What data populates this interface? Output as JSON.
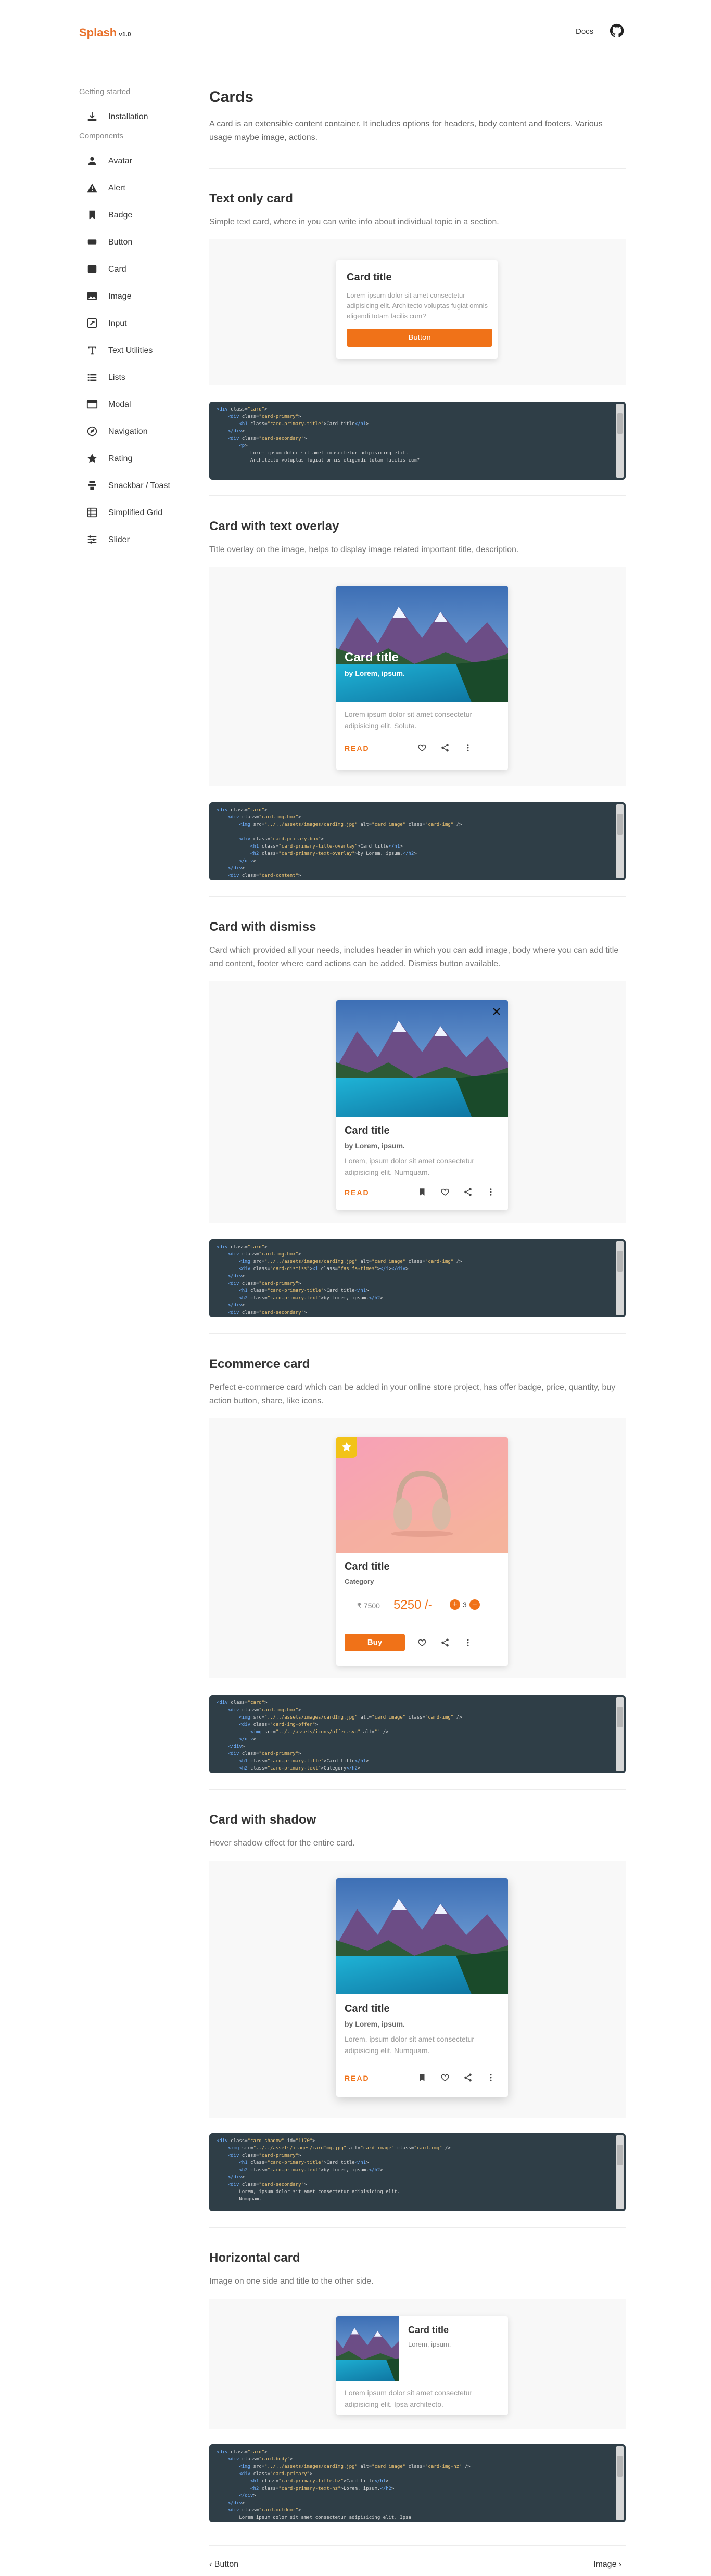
{
  "brand": {
    "name": "Splash",
    "version": "v1.0"
  },
  "topnav": {
    "docs": "Docs"
  },
  "sidebar": {
    "getting_started": "Getting started",
    "installation": "Installation",
    "components": "Components",
    "items": [
      "Avatar",
      "Alert",
      "Badge",
      "Button",
      "Card",
      "Image",
      "Input",
      "Text Utilities",
      "Lists",
      "Modal",
      "Navigation",
      "Rating",
      "Snackbar / Toast",
      "Simplified Grid",
      "Slider"
    ]
  },
  "page": {
    "title": "Cards",
    "lead": "A card is an extensible content container. It includes options for headers, body content and footers. Various usage maybe image, actions."
  },
  "sections": {
    "text_only": {
      "title": "Text only card",
      "desc": "Simple text card, where in you can write info about individual topic in a section.",
      "card_title": "Card title",
      "card_text": "Lorem ipsum dolor sit amet consectetur adipisicing elit. Architecto voluptas fugiat omnis eligendi totam facilis cum?",
      "button": "Button",
      "code": [
        "<div class=\"card\">",
        "    <div class=\"card-primary\">",
        "        <h1 class=\"card-primary-title\">Card title</h1>",
        "    </div>",
        "    <div class=\"card-secondary\">",
        "        <p>",
        "            Lorem ipsum dolor sit amet consectetur adipisicing elit.",
        "            Architecto voluptas fugiat omnis eligendi totam facilis cum?"
      ]
    },
    "overlay": {
      "title": "Card with text overlay",
      "desc": "Title overlay on the image, helps to display image related important title, description.",
      "card_title": "Card title",
      "card_sub": "by Lorem, ipsum.",
      "card_text": "Lorem ipsum dolor sit amet consectetur adipisicing elit. Soluta.",
      "read": "READ",
      "code": [
        "<div class=\"card\">",
        "    <div class=\"card-img-box\">",
        "        <img src=\"../../assets/images/cardImg.jpg\" alt=\"card image\" class=\"card-img\" />",
        "",
        "        <div class=\"card-primary-box\">",
        "            <h1 class=\"card-primary-title-overlay\">Card title</h1>",
        "            <h2 class=\"card-primary-text-overlay\">by Lorem, ipsum.</h2>",
        "        </div>",
        "    </div>",
        "    <div class=\"card-content\">"
      ]
    },
    "dismiss": {
      "title": "Card with dismiss",
      "desc": "Card which provided all your needs, includes header in which you can add image, body where you can add title and content, footer where card actions can be added. Dismiss button available.",
      "card_title": "Card title",
      "card_sub": "by Lorem, ipsum.",
      "card_text": "Lorem, ipsum dolor sit amet consectetur adipisicing elit. Numquam.",
      "read": "READ",
      "code": [
        "<div class=\"card\">",
        "    <div class=\"card-img-box\">",
        "        <img src=\"../../assets/images/cardImg.jpg\" alt=\"card image\" class=\"card-img\" />",
        "        <div class=\"card-dismiss\"><i class=\"fas fa-times\"></i></div>",
        "    </div>",
        "    <div class=\"card-primary\">",
        "        <h1 class=\"card-primary-title\">Card title</h1>",
        "        <h2 class=\"card-primary-text\">by Lorem, ipsum.</h2>",
        "    </div>",
        "    <div class=\"card-secondary\">"
      ]
    },
    "ecommerce": {
      "title": "Ecommerce card",
      "desc": "Perfect e-commerce card which can be added in your online store project, has offer badge, price, quantity, buy action button, share, like icons.",
      "card_title": "Card title",
      "category": "Category",
      "old_price": "₹ 7500",
      "price": "5250 /-",
      "qty": "3",
      "buy": "Buy",
      "code": [
        "<div class=\"card\">",
        "    <div class=\"card-img-box\">",
        "        <img src=\"../../assets/images/cardImg.jpg\" alt=\"card image\" class=\"card-img\" />",
        "        <div class=\"card-img-offer\">",
        "            <img src=\"../../assets/icons/offer.svg\" alt=\"\" />",
        "        </div>",
        "    </div>",
        "    <div class=\"card-primary\">",
        "        <h1 class=\"card-primary-title\">Card title</h1>",
        "        <h2 class=\"card-primary-text\">Category</h2>"
      ]
    },
    "shadow": {
      "title": "Card with shadow",
      "desc": "Hover shadow effect for the entire card.",
      "card_title": "Card title",
      "card_sub": "by Lorem, ipsum.",
      "card_text": "Lorem, ipsum dolor sit amet consectetur adipisicing elit. Numquam.",
      "read": "READ",
      "code": [
        "<div class=\"card shadow\" id=\"1170\">",
        "    <img src=\"../../assets/images/cardImg.jpg\" alt=\"card image\" class=\"card-img\" />",
        "    <div class=\"card-primary\">",
        "        <h1 class=\"card-primary-title\">Card title</h1>",
        "        <h2 class=\"card-primary-text\">by Lorem, ipsum.</h2>",
        "    </div>",
        "    <div class=\"card-secondary\">",
        "        Lorem, ipsum dolor sit amet consectetur adipisicing elit.",
        "        Numquam."
      ]
    },
    "horizontal": {
      "title": "Horizontal card",
      "desc": "Image on one side and title to the other side.",
      "card_title": "Card title",
      "card_sub": "Lorem, ipsum.",
      "card_text": "Lorem ipsum dolor sit amet consectetur adipisicing elit. Ipsa architecto.",
      "code": [
        "<div class=\"card\">",
        "    <div class=\"card-body\">",
        "        <img src=\"../../assets/images/cardImg.jpg\" alt=\"card image\" class=\"card-img-hz\" />",
        "        <div class=\"card-primary\">",
        "            <h1 class=\"card-primary-title-hz\">Card title</h1>",
        "            <h2 class=\"card-primary-text-hz\">Lorem, ipsum.</h2>",
        "        </div>",
        "    </div>",
        "    <div class=\"card-outdoor\">",
        "        Lorem ipsum dolor sit amet consectetur adipisicing elit. Ipsa"
      ]
    }
  },
  "pager": {
    "prev": "Button",
    "next": "Image"
  }
}
